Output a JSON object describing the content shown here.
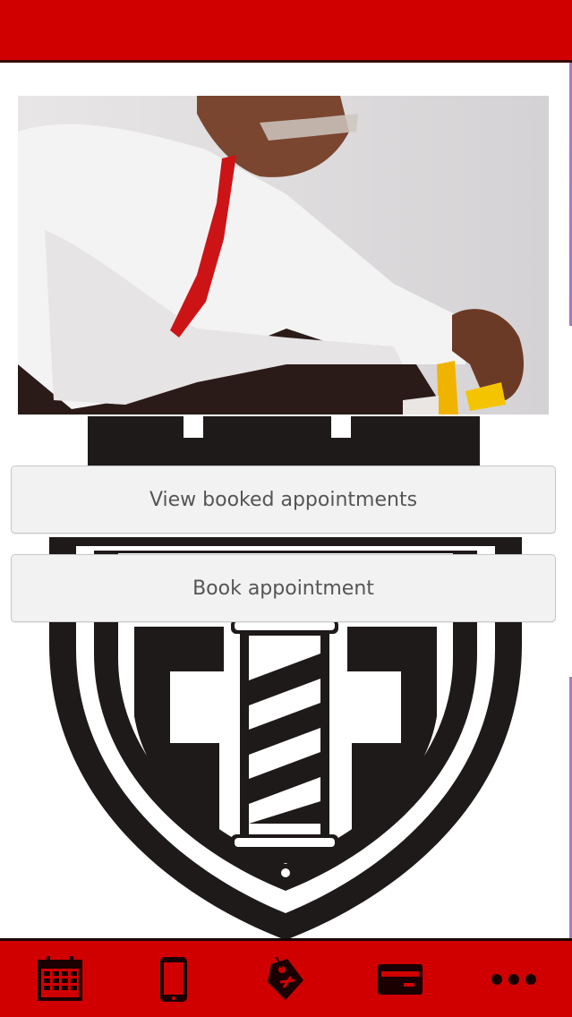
{
  "app": {
    "brand_colors": {
      "primary": "#d00000",
      "dark": "#1e1a1a",
      "button_bg": "#f2f2f2",
      "button_text": "#555555"
    }
  },
  "header": {},
  "main": {
    "hero_image": {
      "description": "barber-working-photo"
    },
    "buttons": {
      "view_booked": "View booked appointments",
      "book": "Book appointment"
    }
  },
  "bottom_nav": {
    "items": [
      {
        "icon": "calendar-icon"
      },
      {
        "icon": "mobile-phone-icon"
      },
      {
        "icon": "tag-icon"
      },
      {
        "icon": "credit-card-icon"
      },
      {
        "icon": "more-dots-icon"
      }
    ]
  }
}
